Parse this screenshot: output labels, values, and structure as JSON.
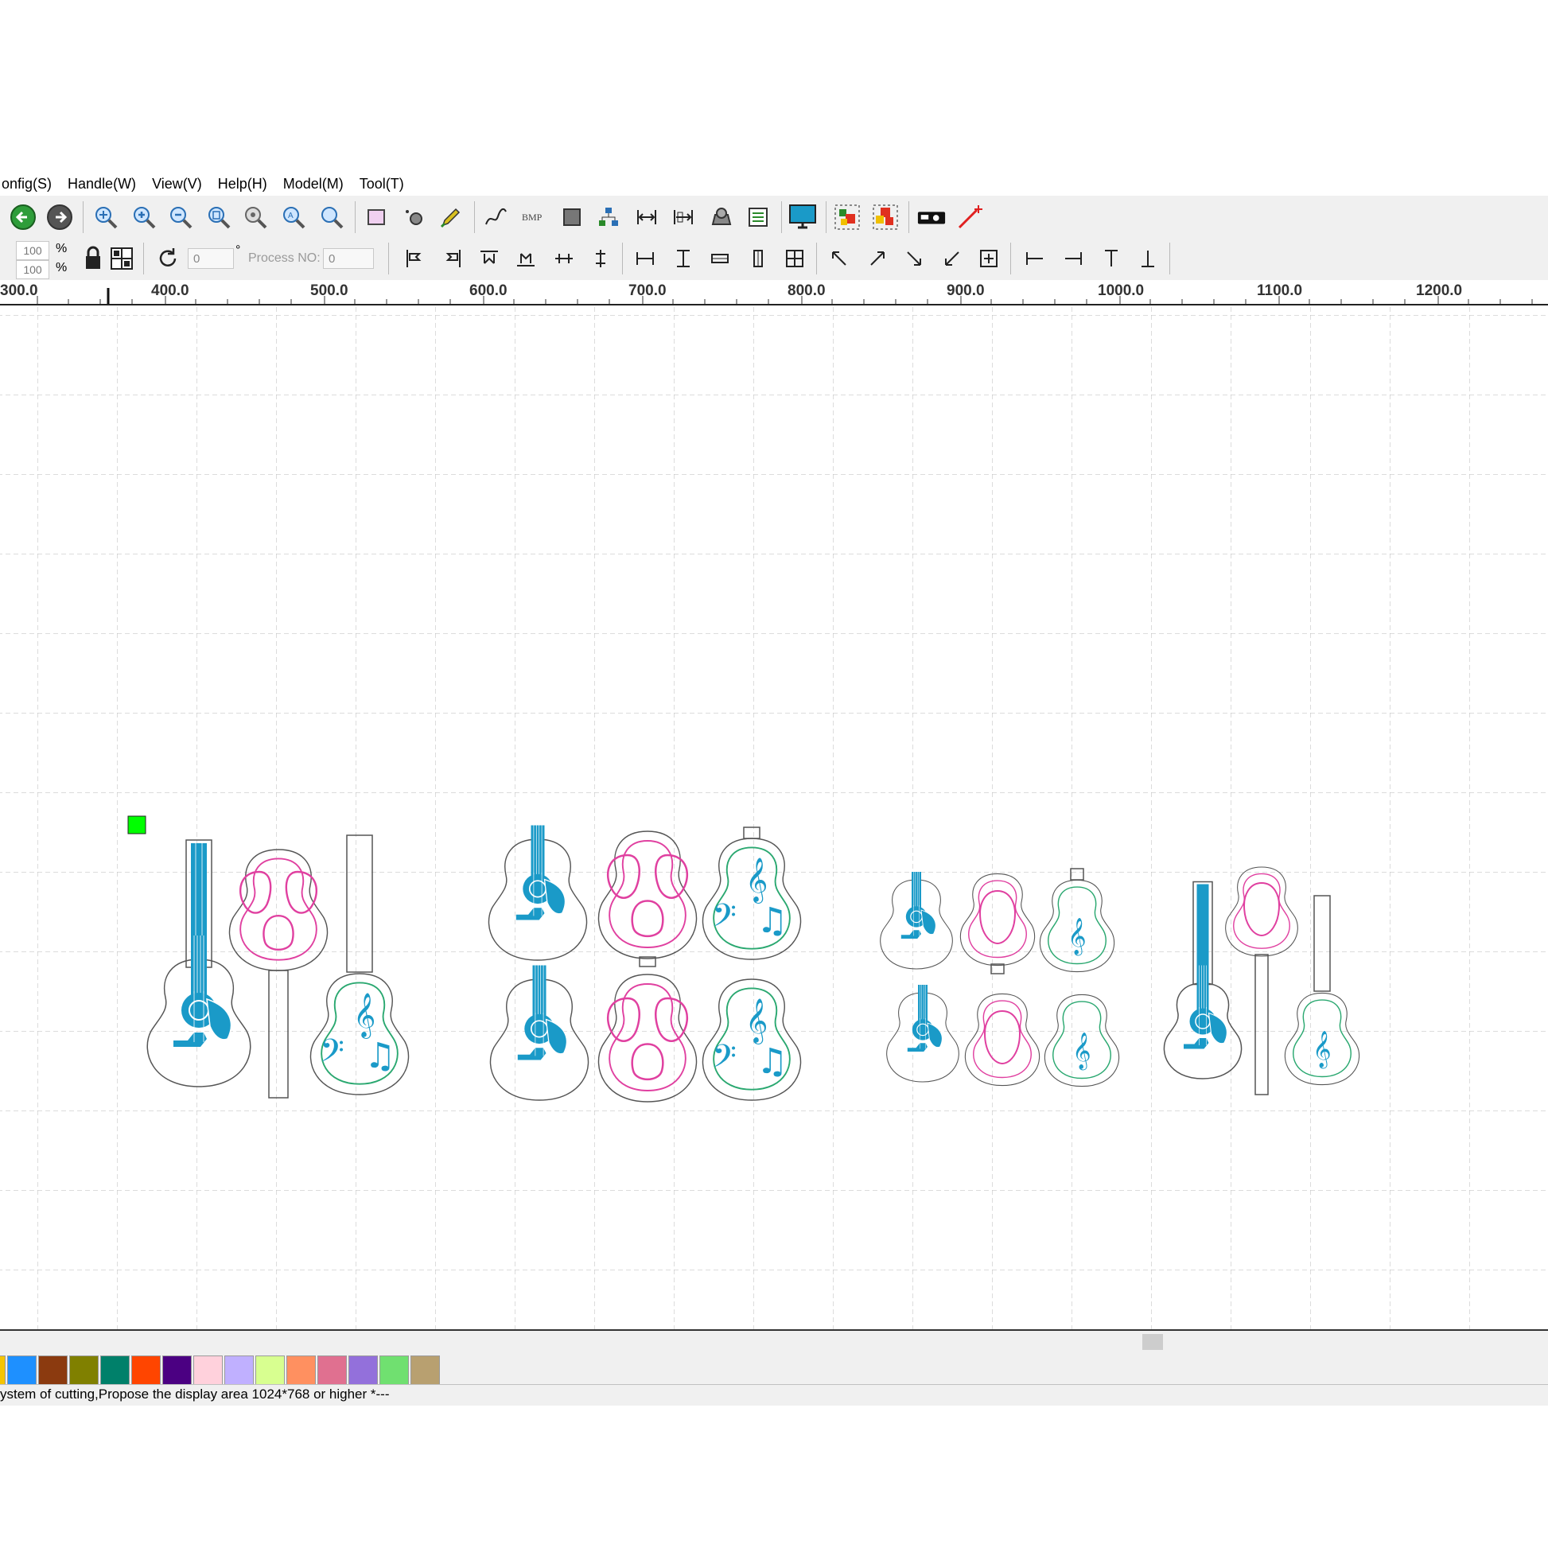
{
  "menu": [
    "onfig(S)",
    "Handle(W)",
    "View(V)",
    "Help(H)",
    "Model(M)",
    "Tool(T)"
  ],
  "toolbar2": {
    "scale_x": "100",
    "scale_y": "100",
    "percent": "%",
    "rotation": "0",
    "degree": "°",
    "process_label": "Process NO:",
    "process_value": "0"
  },
  "ruler": [
    "300.0",
    "400.0",
    "500.0",
    "600.0",
    "700.0",
    "800.0",
    "900.0",
    "1000.0",
    "1100.0",
    "1200.0"
  ],
  "palette": [
    "#f5c400",
    "#1e90ff",
    "#8b3a0f",
    "#808000",
    "#00806a",
    "#ff4500",
    "#4b0082",
    "#ffd1dc",
    "#c0b0ff",
    "#d8ff90",
    "#ff9060",
    "#e07090",
    "#9370db",
    "#70e070",
    "#b8a070"
  ],
  "colors": {
    "engrave": "#1a9ac8",
    "pink": "#e040a0",
    "green": "#2aa870",
    "outline": "#555555",
    "marker": "#00ff00"
  },
  "status": "ystem of cutting,Propose the display area 1024*768 or higher *---"
}
